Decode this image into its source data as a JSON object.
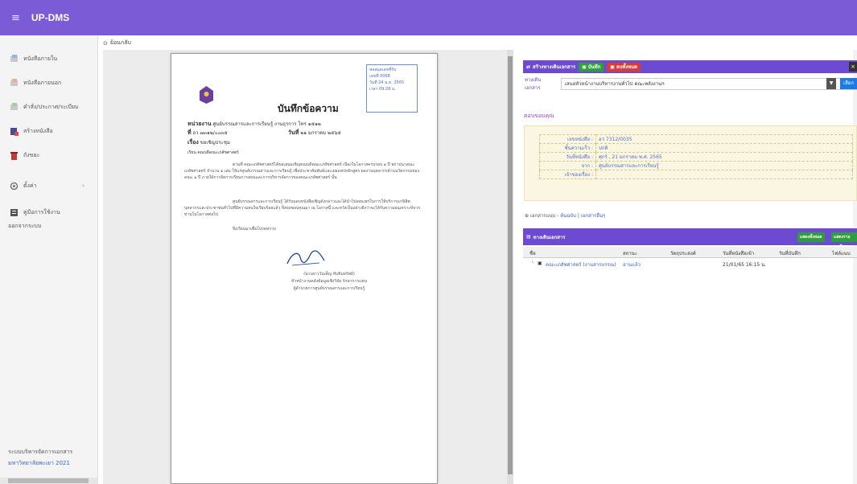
{
  "app": {
    "title": "UP-DMS",
    "menu_icon": "hamburger-icon"
  },
  "sidebar": {
    "items": [
      {
        "label": "หนังสือภายใน",
        "icon": "inbox-icon"
      },
      {
        "label": "หนังสือภายนอก",
        "icon": "outbox-icon"
      },
      {
        "label": "คำสั่ง/ประกาศ/ระเบียบ",
        "icon": "announce-icon"
      },
      {
        "label": "สร้างหนังสือ",
        "icon": "create-doc-icon"
      },
      {
        "label": "ถังขยะ",
        "icon": "trash-icon"
      },
      {
        "label": "ตั้งค่า",
        "icon": "settings-icon"
      },
      {
        "label": "คู่มือการใช้งาน",
        "icon": "manual-icon"
      },
      {
        "label": "ออกจากระบบ",
        "icon": ""
      }
    ],
    "footer_title": "ระบบบริหารจัดการเอกสาร",
    "footer_org": "มหาวิทยาลัยพะเยา 2021"
  },
  "content": {
    "back_label": "ย้อนกลับ"
  },
  "memo": {
    "stamp": [
      "หอสมุดเลขที่รับ",
      "เลขที่ 0068",
      "วันที่ 24 ม.ค. 2565",
      "เวลา 09.28 น."
    ],
    "title": "บันทึกข้อความ",
    "agency_label": "หน่วยงาน",
    "agency_value": "ศูนย์บรรณสารและการเรียนรู้  งานธุรการ  โทร ๑๕๑๒",
    "number_label": "ที่",
    "number_value": "อว ๗๓๑๒/๐๐๓๕",
    "date_label": "วันที่",
    "date_value": "๒๑ มกราคม ๒๕๖๕",
    "subject_label": "เรื่อง",
    "subject_value": "ขอเชิญประชุม",
    "to_line": "เรียน  คณบดีคณะเภสัชศาสตร์",
    "para1": "ตามที่ คณะเภสัชศาสตร์ได้ขอเสนอเชิญคณบดีคณะเภสัชศาสตร์ เนื่องในโอกาสครบรอบ ๑ ปี สถาปนาคณะเภสัชศาสตร์ จำนวน ๑ เล่ม ให้แก่ศูนย์บรรณสารและการเรียนรู้ เพื่อประชาสัมพันธ์และเผยแพร่หลักสูตร ผลงานบุคลากรด้านนวัตกรรมของคณะ ๑ ปี ภายใต้การจัดการเรียนการสอนและการบริหารจัดการของคณะเภสัชศาสตร์ นั้น",
    "para2": "ศูนย์บรรณสารและการเรียนรู้ ได้รับมอบหนังสือเชิญดังกล่าวและได้นำไปเผยแพร่ในการให้บริการแก่นิสิต บุคลากรและประชาชนทั่วไปที่มีความสนใจเรียบร้อยแล้ว จึงขอขอบคุณมา ณ โอกาสนี้ และหวังเป็นอย่างยิ่งว่าจะได้รับความอนุเคราะห์จากท่านในโอกาสต่อไป",
    "closing": "จึงเรียนมาเพื่อโปรดทราบ",
    "signer_name": "(นางสาววันเพ็ญ ทับทิมทรัพย์)",
    "signer_title1": "หัวหน้างานคลังข้อมูลเชิงวิจัย รักษาการแทน",
    "signer_title2": "ผู้อำนวยการศูนย์บรรณสารและการเรียนรู้"
  },
  "workflow": {
    "toolbar_title": "สร้างทางเดินเอกสาร",
    "btn_save": "บันทึก",
    "btn_reset": "ลบทั้งหมด",
    "close_label": "×",
    "flow_label": "ทางเดินเอกสาร",
    "flow_value": "เสนอหัวหน้างานบริหารงานทั่วไป คณะพลังงานฯ",
    "choose_label": "เลือก",
    "details_title": "ตอบขอบคุณ",
    "fields": [
      {
        "k": "เลขหนังสือ :",
        "v": "อว 7312/0035"
      },
      {
        "k": "ชั้นความเร็ว :",
        "v": "ปกติ"
      },
      {
        "k": "วันที่หนังสือ :",
        "v": "ศุกร์ , 21 มกราคม พ.ศ. 2565"
      },
      {
        "k": "จาก :",
        "v": "ศูนย์บรรณสารและการเรียนรู้"
      },
      {
        "k": "เจ้าของเรื่อง :",
        "v": ""
      }
    ],
    "attachments_label": "เอกสารแนบ -",
    "attachments_links": "ต้นฉบับ | เอกสารอื่นๆ",
    "grid_title": "ทางเดินเอกสาร",
    "grid_btn1": "แสดงทั้งหมด",
    "grid_btn2": "แสดงรายละเอียด",
    "columns": [
      "ชื่อ",
      "สถานะ",
      "วัตถุประสงค์",
      "วันที่หนังสือเข้า",
      "วันที่บันทึก",
      "ไฟล์แนบ"
    ],
    "rows": [
      {
        "name": "คณะเภสัชศาสตร์ (งานสารบรรณ)",
        "status": "อ่านแล้ว",
        "purpose": "",
        "in_date": "21/01/65 16:15 น.",
        "saved": "",
        "file": ""
      }
    ]
  }
}
